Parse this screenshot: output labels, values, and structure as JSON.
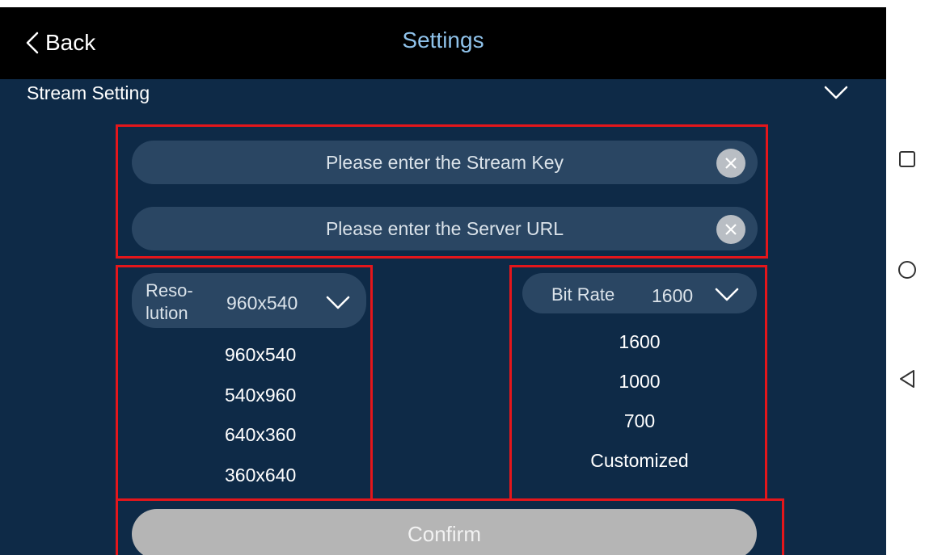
{
  "header": {
    "back_label": "Back",
    "title": "Settings"
  },
  "section": {
    "label": "Stream Setting"
  },
  "inputs": {
    "stream_key_placeholder": "Please enter the Stream Key",
    "server_url_placeholder": "Please enter the Server URL"
  },
  "resolution": {
    "label_line1": "Reso-",
    "label_line2": "lution",
    "selected": "960x540",
    "options": [
      "960x540",
      "540x960",
      "640x360",
      "360x640"
    ]
  },
  "bitrate": {
    "label": "Bit Rate",
    "selected": "1600",
    "options": [
      "1600",
      "1000",
      "700",
      "Customized"
    ]
  },
  "confirm_label": "Confirm",
  "colors": {
    "highlight": "#e4161b",
    "title": "#8fc2ea",
    "background": "#0e2a47"
  }
}
